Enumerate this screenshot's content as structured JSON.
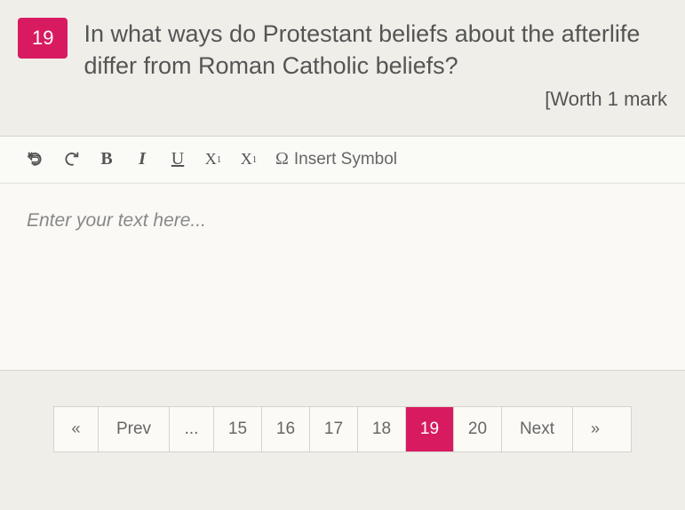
{
  "question": {
    "number": "19",
    "text": "In what ways do Protestant beliefs about the afterlife differ from Roman Catholic beliefs?",
    "worth": "[Worth 1 mark"
  },
  "toolbar": {
    "undo": "↶",
    "redo": "↷",
    "bold": "B",
    "italic": "I",
    "underline": "U",
    "subscript_base": "X",
    "subscript_sub": "1",
    "superscript_base": "X",
    "superscript_sup": "1",
    "symbol_omega": "Ω",
    "insert_symbol": "Insert Symbol"
  },
  "editor": {
    "placeholder": "Enter your text here..."
  },
  "pager": {
    "first": "«",
    "prev": "Prev",
    "dots": "...",
    "pages": [
      "15",
      "16",
      "17",
      "18",
      "19",
      "20"
    ],
    "active": "19",
    "next": "Next",
    "last": "»"
  }
}
